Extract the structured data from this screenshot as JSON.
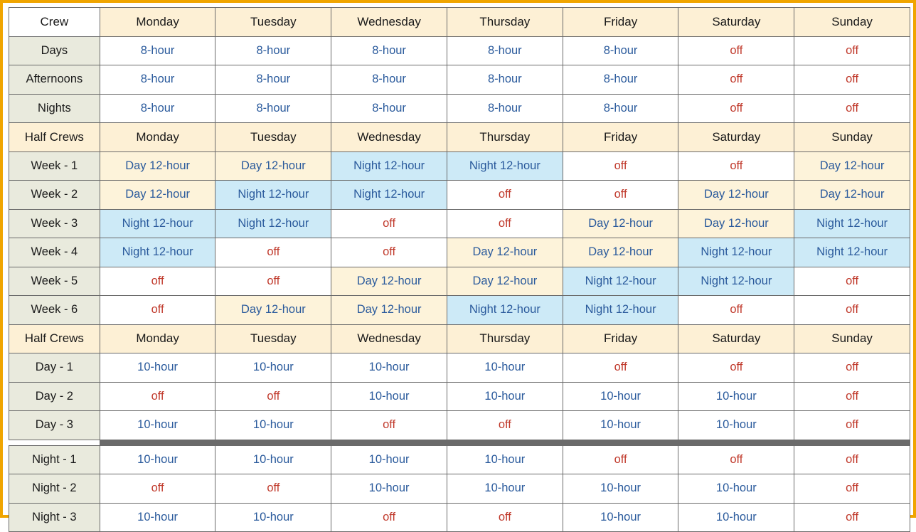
{
  "table": {
    "sections": [
      {
        "header": [
          "Crew",
          "Monday",
          "Tuesday",
          "Wednesday",
          "Thursday",
          "Friday",
          "Saturday",
          "Sunday"
        ],
        "header_first_plain": true,
        "rows": [
          {
            "label": "Days",
            "label_shaded": true,
            "cells": [
              {
                "t": "8-hour",
                "s": "blue"
              },
              {
                "t": "8-hour",
                "s": "blue"
              },
              {
                "t": "8-hour",
                "s": "blue"
              },
              {
                "t": "8-hour",
                "s": "blue"
              },
              {
                "t": "8-hour",
                "s": "blue"
              },
              {
                "t": "off",
                "s": "off"
              },
              {
                "t": "off",
                "s": "off"
              }
            ]
          },
          {
            "label": "Afternoons",
            "label_shaded": true,
            "cells": [
              {
                "t": "8-hour",
                "s": "blue"
              },
              {
                "t": "8-hour",
                "s": "blue"
              },
              {
                "t": "8-hour",
                "s": "blue"
              },
              {
                "t": "8-hour",
                "s": "blue"
              },
              {
                "t": "8-hour",
                "s": "blue"
              },
              {
                "t": "off",
                "s": "off"
              },
              {
                "t": "off",
                "s": "off"
              }
            ]
          },
          {
            "label": "Nights",
            "label_shaded": true,
            "cells": [
              {
                "t": "8-hour",
                "s": "blue"
              },
              {
                "t": "8-hour",
                "s": "blue"
              },
              {
                "t": "8-hour",
                "s": "blue"
              },
              {
                "t": "8-hour",
                "s": "blue"
              },
              {
                "t": "8-hour",
                "s": "blue"
              },
              {
                "t": "off",
                "s": "off"
              },
              {
                "t": "off",
                "s": "off"
              }
            ]
          }
        ]
      },
      {
        "header": [
          "Half Crews",
          "Monday",
          "Tuesday",
          "Wednesday",
          "Thursday",
          "Friday",
          "Saturday",
          "Sunday"
        ],
        "header_first_plain": false,
        "rows": [
          {
            "label": "Week - 1",
            "label_shaded": true,
            "cells": [
              {
                "t": "Day 12-hour",
                "s": "day"
              },
              {
                "t": "Day 12-hour",
                "s": "day"
              },
              {
                "t": "Night 12-hour",
                "s": "night"
              },
              {
                "t": "Night 12-hour",
                "s": "night"
              },
              {
                "t": "off",
                "s": "off"
              },
              {
                "t": "off",
                "s": "off"
              },
              {
                "t": "Day 12-hour",
                "s": "day"
              }
            ]
          },
          {
            "label": "Week - 2",
            "label_shaded": true,
            "cells": [
              {
                "t": "Day 12-hour",
                "s": "day"
              },
              {
                "t": "Night 12-hour",
                "s": "night"
              },
              {
                "t": "Night 12-hour",
                "s": "night"
              },
              {
                "t": "off",
                "s": "off"
              },
              {
                "t": "off",
                "s": "off"
              },
              {
                "t": "Day 12-hour",
                "s": "day"
              },
              {
                "t": "Day 12-hour",
                "s": "day"
              }
            ]
          },
          {
            "label": "Week - 3",
            "label_shaded": true,
            "cells": [
              {
                "t": "Night 12-hour",
                "s": "night"
              },
              {
                "t": "Night 12-hour",
                "s": "night"
              },
              {
                "t": "off",
                "s": "off"
              },
              {
                "t": "off",
                "s": "off"
              },
              {
                "t": "Day 12-hour",
                "s": "day"
              },
              {
                "t": "Day 12-hour",
                "s": "day"
              },
              {
                "t": "Night 12-hour",
                "s": "night"
              }
            ]
          },
          {
            "label": "Week - 4",
            "label_shaded": true,
            "cells": [
              {
                "t": "Night 12-hour",
                "s": "night"
              },
              {
                "t": "off",
                "s": "off"
              },
              {
                "t": "off",
                "s": "off"
              },
              {
                "t": "Day 12-hour",
                "s": "day"
              },
              {
                "t": "Day 12-hour",
                "s": "day"
              },
              {
                "t": "Night 12-hour",
                "s": "night"
              },
              {
                "t": "Night 12-hour",
                "s": "night"
              }
            ]
          },
          {
            "label": "Week - 5",
            "label_shaded": true,
            "cells": [
              {
                "t": "off",
                "s": "off"
              },
              {
                "t": "off",
                "s": "off"
              },
              {
                "t": "Day 12-hour",
                "s": "day"
              },
              {
                "t": "Day 12-hour",
                "s": "day"
              },
              {
                "t": "Night 12-hour",
                "s": "night"
              },
              {
                "t": "Night 12-hour",
                "s": "night"
              },
              {
                "t": "off",
                "s": "off"
              }
            ]
          },
          {
            "label": "Week - 6",
            "label_shaded": true,
            "cells": [
              {
                "t": "off",
                "s": "off"
              },
              {
                "t": "Day 12-hour",
                "s": "day"
              },
              {
                "t": "Day 12-hour",
                "s": "day"
              },
              {
                "t": "Night 12-hour",
                "s": "night"
              },
              {
                "t": "Night 12-hour",
                "s": "night"
              },
              {
                "t": "off",
                "s": "off"
              },
              {
                "t": "off",
                "s": "off"
              }
            ]
          }
        ]
      },
      {
        "header": [
          "Half Crews",
          "Monday",
          "Tuesday",
          "Wednesday",
          "Thursday",
          "Friday",
          "Saturday",
          "Sunday"
        ],
        "header_first_plain": false,
        "rows": [
          {
            "label": "Day - 1",
            "label_shaded": true,
            "cells": [
              {
                "t": "10-hour",
                "s": "blue"
              },
              {
                "t": "10-hour",
                "s": "blue"
              },
              {
                "t": "10-hour",
                "s": "blue"
              },
              {
                "t": "10-hour",
                "s": "blue"
              },
              {
                "t": "off",
                "s": "off"
              },
              {
                "t": "off",
                "s": "off"
              },
              {
                "t": "off",
                "s": "off"
              }
            ]
          },
          {
            "label": "Day - 2",
            "label_shaded": true,
            "cells": [
              {
                "t": "off",
                "s": "off"
              },
              {
                "t": "off",
                "s": "off"
              },
              {
                "t": "10-hour",
                "s": "blue"
              },
              {
                "t": "10-hour",
                "s": "blue"
              },
              {
                "t": "10-hour",
                "s": "blue"
              },
              {
                "t": "10-hour",
                "s": "blue"
              },
              {
                "t": "off",
                "s": "off"
              }
            ]
          },
          {
            "label": "Day - 3",
            "label_shaded": true,
            "cells": [
              {
                "t": "10-hour",
                "s": "blue"
              },
              {
                "t": "10-hour",
                "s": "blue"
              },
              {
                "t": "off",
                "s": "off"
              },
              {
                "t": "off",
                "s": "off"
              },
              {
                "t": "10-hour",
                "s": "blue"
              },
              {
                "t": "10-hour",
                "s": "blue"
              },
              {
                "t": "off",
                "s": "off"
              }
            ]
          }
        ],
        "divider_after": true
      },
      {
        "rows": [
          {
            "label": "Night - 1",
            "label_shaded": true,
            "cells": [
              {
                "t": "10-hour",
                "s": "blue"
              },
              {
                "t": "10-hour",
                "s": "blue"
              },
              {
                "t": "10-hour",
                "s": "blue"
              },
              {
                "t": "10-hour",
                "s": "blue"
              },
              {
                "t": "off",
                "s": "off"
              },
              {
                "t": "off",
                "s": "off"
              },
              {
                "t": "off",
                "s": "off"
              }
            ]
          },
          {
            "label": "Night - 2",
            "label_shaded": true,
            "cells": [
              {
                "t": "off",
                "s": "off"
              },
              {
                "t": "off",
                "s": "off"
              },
              {
                "t": "10-hour",
                "s": "blue"
              },
              {
                "t": "10-hour",
                "s": "blue"
              },
              {
                "t": "10-hour",
                "s": "blue"
              },
              {
                "t": "10-hour",
                "s": "blue"
              },
              {
                "t": "off",
                "s": "off"
              }
            ]
          },
          {
            "label": "Night - 3",
            "label_shaded": true,
            "cells": [
              {
                "t": "10-hour",
                "s": "blue"
              },
              {
                "t": "10-hour",
                "s": "blue"
              },
              {
                "t": "off",
                "s": "off"
              },
              {
                "t": "off",
                "s": "off"
              },
              {
                "t": "10-hour",
                "s": "blue"
              },
              {
                "t": "10-hour",
                "s": "blue"
              },
              {
                "t": "off",
                "s": "off"
              }
            ]
          }
        ]
      }
    ]
  },
  "colors": {
    "border_frame": "#f0a500",
    "header_bg": "#fdf0d5",
    "label_bg": "#e9eadd",
    "day_bg": "#fdf3da",
    "night_bg": "#cdeaf7",
    "text_blue": "#2a5a9c",
    "text_off": "#c0392b",
    "grid": "#6a6a6a"
  }
}
